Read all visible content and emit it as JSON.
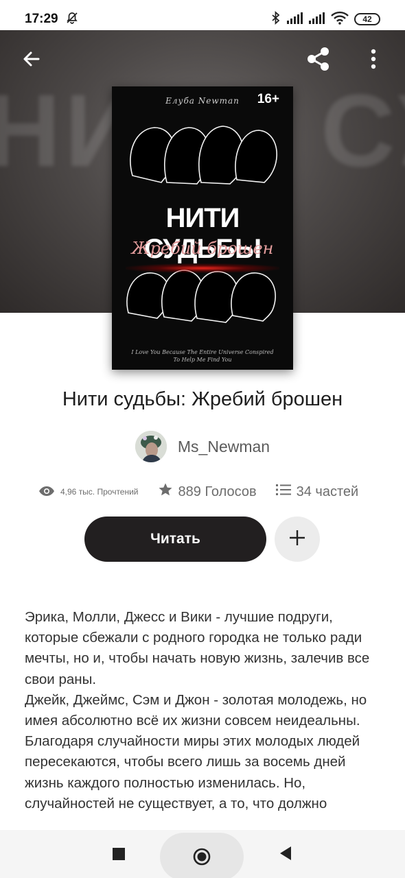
{
  "status_bar": {
    "time": "17:29",
    "battery": "42",
    "icons": [
      "bell-off-icon",
      "bluetooth-icon",
      "signal-icon",
      "signal-icon",
      "wifi-icon",
      "battery-icon"
    ]
  },
  "hero": {
    "blur_text": "НИТИ СУДЬБЫ",
    "icons": [
      "back-arrow-icon",
      "share-icon",
      "more-vert-icon"
    ]
  },
  "cover": {
    "author": "Eлуба Newman",
    "age_rating": "16+",
    "title": "НИТИ СУДЬБЫ",
    "subtitle": "Жребий брошен",
    "tagline": "I Love You Because The Entire Universe Conspired To Help Me Find You"
  },
  "book": {
    "title": "Нити судьбы: Жребий брошен",
    "author": "Ms_Newman"
  },
  "stats": {
    "reads": "4,96 тыс. Прочтений",
    "votes": "889 Голосов",
    "parts": "34 частей"
  },
  "actions": {
    "read_label": "Читать",
    "add_icon": "plus-icon"
  },
  "description": {
    "paragraphs": [
      "Эрика, Молли, Джесс и Вики - лучшие подруги, которые сбежали с родного городка не только ради мечты, но и, чтобы начать новую жизнь, залечив все свои раны.",
      "Джейк, Джеймс, Сэм и Джон - золотая молодежь, но имея абсолютно всё их жизни совсем неидеальны.",
      "Благодаря случайности миры этих молодых людей пересекаются, чтобы всего лишь за восемь дней жизнь каждого полностью изменилась. Но, случайностей не существует, а то, что должно"
    ]
  },
  "nav_bar": {
    "icons": [
      "recents-icon",
      "home-icon",
      "back-icon"
    ]
  },
  "colors": {
    "read_button_bg": "#221f20",
    "add_button_bg": "#ececec",
    "text_primary": "#1e1e1e",
    "text_secondary": "#6d6d6d"
  }
}
